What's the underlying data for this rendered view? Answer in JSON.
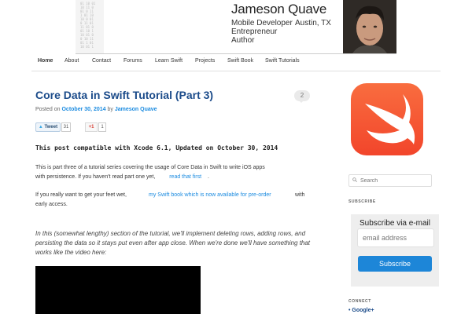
{
  "header": {
    "name": "Jameson Quave",
    "lines": [
      "Mobile Developer",
      "Entrepreneur",
      "Author"
    ],
    "location": "Austin, TX"
  },
  "nav": {
    "items": [
      "Home",
      "About",
      "Contact",
      "Forums",
      "Learn Swift",
      "Projects",
      "Swift Book",
      "Swift Tutorials"
    ]
  },
  "post": {
    "title": "Core Data in Swift Tutorial (Part 3)",
    "comments": "2",
    "meta_prefix": "Posted on",
    "date": "October 30, 2014",
    "by": "by",
    "author": "Jameson Quave",
    "tweet_label": "Tweet",
    "tweet_count": "31",
    "gplus_label": "+1",
    "gplus_count": "1",
    "compat": "This post compatible with Xcode 6.1, Updated on October 30, 2014",
    "p1_line1": "This is part three of a tutorial series covering the usage of Core Data in Swift to write iOS apps",
    "p1_line2": "with persistence. If you haven't read part one yet,",
    "p1_link": "read that first",
    "p1_end": ".",
    "p2_start": "If you really want to get your feet wet,",
    "p2_link": "my Swift book which is now available for pre-order",
    "p2_with": "with",
    "p2_line2": "early access.",
    "italic": "In this (somewhat lengthy) section of the tutorial, we'll implement deleting rows, adding rows, and persisting the data so it stays put even after app close. When we're done we'll have something that works like the video here:"
  },
  "sidebar": {
    "search_placeholder": "Search",
    "subscribe_heading": "SUBSCRIBE",
    "subscribe_title": "Subscribe via e-mail",
    "email_placeholder": "email address",
    "subscribe_button": "Subscribe",
    "connect_heading": "CONNECT",
    "gplus_link": "Google+"
  },
  "colors": {
    "link": "#1b8be0",
    "title": "#1b4b8a",
    "button": "#1d86d8",
    "swift_orange": "#f96d3f"
  }
}
